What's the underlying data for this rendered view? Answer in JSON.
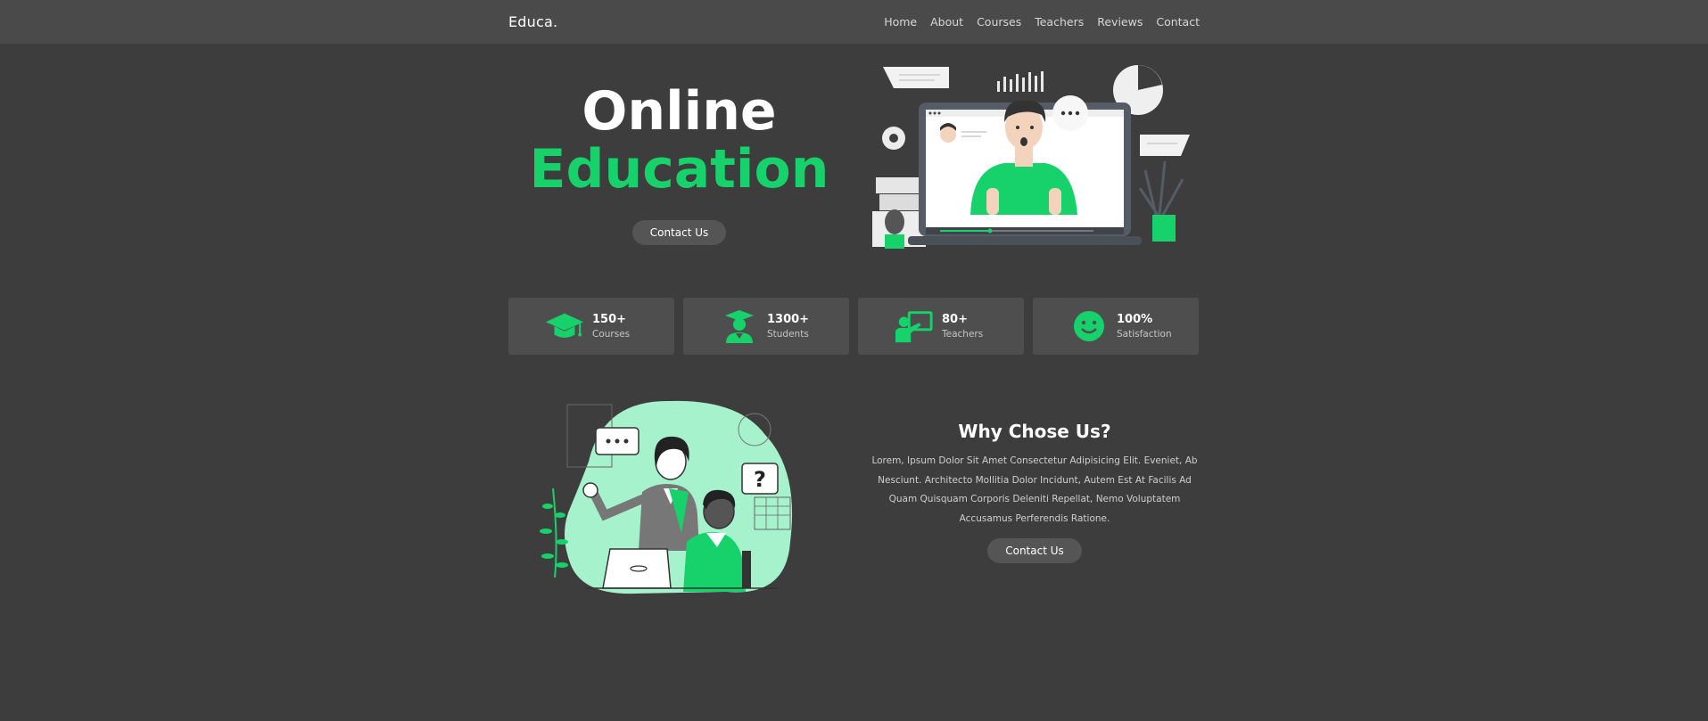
{
  "header": {
    "logo": "Educa.",
    "nav": [
      "Home",
      "About",
      "Courses",
      "Teachers",
      "Reviews",
      "Contact"
    ]
  },
  "hero": {
    "title_line1": "Online",
    "title_line2": "Education",
    "button_label": "Contact Us"
  },
  "stats": [
    {
      "value": "150+",
      "label": "Courses",
      "icon": "graduation-cap-icon"
    },
    {
      "value": "1300+",
      "label": "Students",
      "icon": "student-icon"
    },
    {
      "value": "80+",
      "label": "Teachers",
      "icon": "teacher-icon"
    },
    {
      "value": "100%",
      "label": "Satisfaction",
      "icon": "smiley-icon"
    }
  ],
  "why": {
    "title": "Why Chose Us?",
    "body": "Lorem, Ipsum Dolor Sit Amet Consectetur Adipisicing Elit. Eveniet, Ab Nesciunt. Architecto Mollitia Dolor Incidunt, Autem Est At Facilis Ad Quam Quisquam Corporis Deleniti Repellat, Nemo Voluptatem Accusamus Perferendis Ratione.",
    "button_label": "Contact Us"
  },
  "colors": {
    "accent": "#17d26b",
    "background": "#3d3d3d",
    "header": "#4a4a4a",
    "card": "#4e4e4e"
  }
}
